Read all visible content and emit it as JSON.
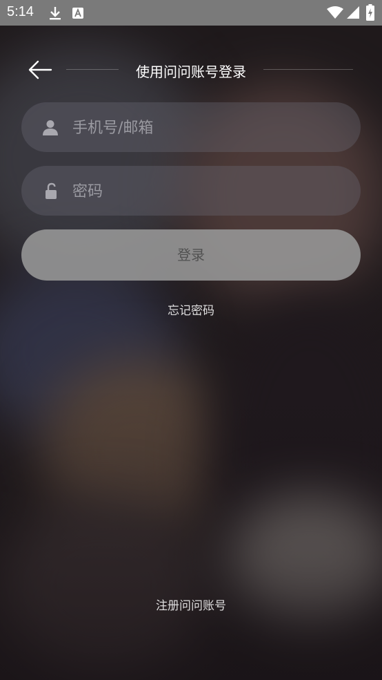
{
  "status_bar": {
    "time": "5:14",
    "icons": [
      "download-icon",
      "a-notification-icon",
      "wifi-icon",
      "cellular-signal-icon",
      "battery-charging-icon"
    ]
  },
  "header": {
    "title": "使用问问账号登录"
  },
  "form": {
    "phone_placeholder": "手机号/邮箱",
    "password_placeholder": "密码",
    "login_label": "登录"
  },
  "links": {
    "forgot_password": "忘记密码",
    "register": "注册问问账号"
  },
  "colors": {
    "status_bar_bg": "#7a7a7a",
    "field_bg": "rgba(110,110,120,0.35)",
    "login_button_bg": "#969696"
  }
}
